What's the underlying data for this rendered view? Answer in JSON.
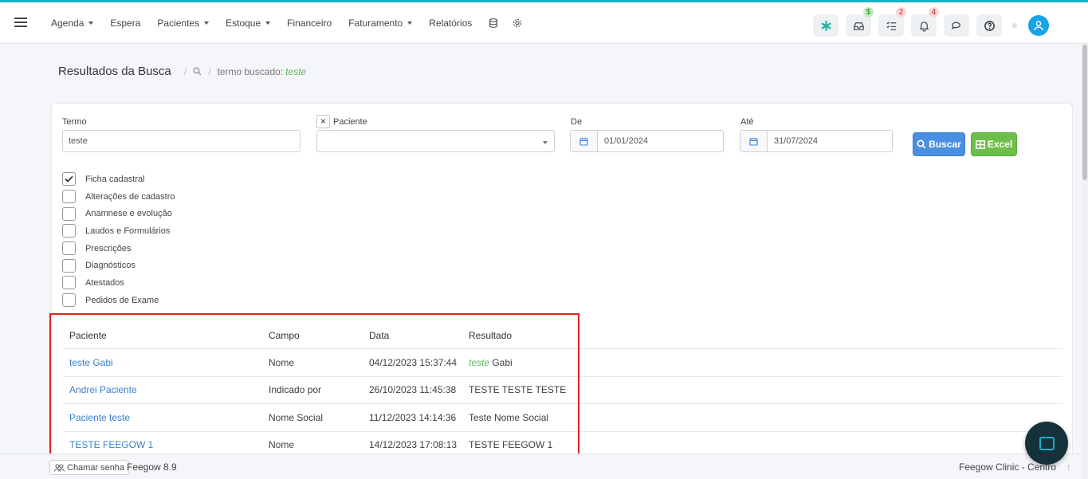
{
  "nav": {
    "items": [
      {
        "label": "Agenda",
        "dropdown": true
      },
      {
        "label": "Espera",
        "dropdown": false
      },
      {
        "label": "Pacientes",
        "dropdown": true
      },
      {
        "label": "Estoque",
        "dropdown": true
      },
      {
        "label": "Financeiro",
        "dropdown": false
      },
      {
        "label": "Faturamento",
        "dropdown": true
      },
      {
        "label": "Relatórios",
        "dropdown": false
      }
    ],
    "extra_icons": [
      "database-icon",
      "gear-icon"
    ]
  },
  "topbar_right": {
    "buttons": [
      {
        "icon": "asterisk-icon",
        "badge": ""
      },
      {
        "icon": "inbox-icon",
        "badge": "$"
      },
      {
        "icon": "checklist-icon",
        "badge": "2"
      },
      {
        "icon": "bell-icon",
        "badge": "4"
      },
      {
        "icon": "chat-icon",
        "badge": ""
      },
      {
        "icon": "help-icon",
        "badge": ""
      }
    ],
    "avatar_icon": "user-icon"
  },
  "breadcrumb": {
    "title": "Resultados da Busca",
    "term_label": "termo buscado:",
    "term_value": "teste"
  },
  "form": {
    "termo_label": "Termo",
    "termo_value": "teste",
    "paciente_label": "Paciente",
    "paciente_clear": "×",
    "paciente_value": "",
    "de_label": "De",
    "de_value": "01/01/2024",
    "ate_label": "Até",
    "ate_value": "31/07/2024",
    "buscar_label": "Buscar",
    "excel_label": "Excel"
  },
  "checkboxes": [
    {
      "label": "Ficha cadastral",
      "checked": true
    },
    {
      "label": "Alterações de cadastro",
      "checked": false
    },
    {
      "label": "Anamnese e evolução",
      "checked": false
    },
    {
      "label": "Laudos e Formulários",
      "checked": false
    },
    {
      "label": "Prescrições",
      "checked": false
    },
    {
      "label": "Diagnósticos",
      "checked": false
    },
    {
      "label": "Atestados",
      "checked": false
    },
    {
      "label": "Pedidos de Exame",
      "checked": false
    }
  ],
  "results": {
    "columns": [
      "Paciente",
      "Campo",
      "Data",
      "Resultado"
    ],
    "rows": [
      {
        "paciente": "teste Gabi",
        "campo": "Nome",
        "data": "04/12/2023 15:37:44",
        "resultado_hl": "teste",
        "resultado": " Gabi"
      },
      {
        "paciente": "Andrei Paciente",
        "campo": "Indicado por",
        "data": "26/10/2023 11:45:38",
        "resultado_hl": "",
        "resultado": "TESTE TESTE TESTE"
      },
      {
        "paciente": "Paciente teste",
        "campo": "Nome Social",
        "data": "11/12/2023 14:14:36",
        "resultado_hl": "",
        "resultado": "Teste Nome Social"
      },
      {
        "paciente": "TESTE FEEGOW 1",
        "campo": "Nome",
        "data": "14/12/2023 17:08:13",
        "resultado_hl": "",
        "resultado": "TESTE FEEGOW 1"
      }
    ]
  },
  "footer": {
    "chamar_label": "Chamar senha",
    "version": "Feegow 8.9",
    "clinic": "Feegow Clinic - Centro"
  },
  "colors": {
    "accent": "#1ab1c4",
    "link": "#3a7fd0",
    "highlight": "#5cb85c",
    "buscar": "#4a90e2",
    "excel": "#6cc04a",
    "annotation": "#e02020"
  }
}
